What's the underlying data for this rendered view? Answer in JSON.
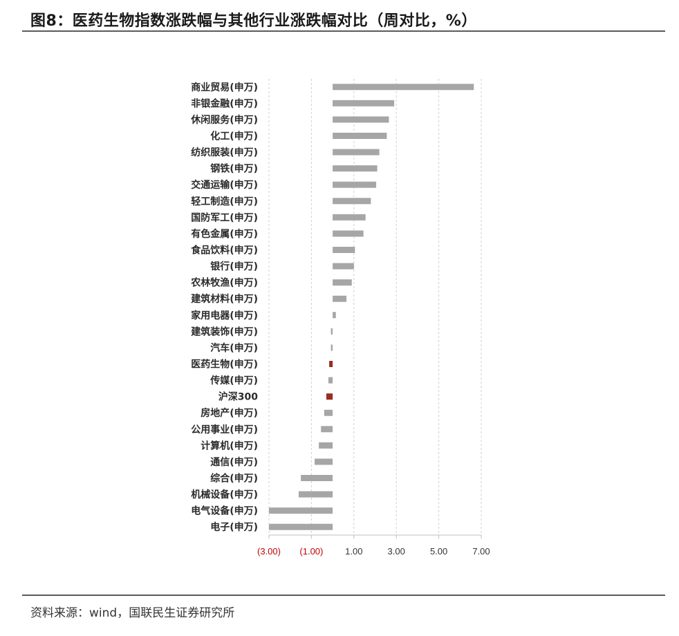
{
  "header": {
    "title": "图8：医药生物指数涨跌幅与其他行业涨跌幅对比（周对比，%）"
  },
  "footer": {
    "source": "资料来源：wind，国联民生证券研究所"
  },
  "colors": {
    "bar": "#a6a6a6",
    "highlight": "#9b2b24",
    "negative_tick": "#c00000",
    "tick": "#333333",
    "grid": "#cfcfcf"
  },
  "chart_data": {
    "type": "bar",
    "orientation": "horizontal",
    "categories": [
      "商业贸易(申万)",
      "非银金融(申万)",
      "休闲服务(申万)",
      "化工(申万)",
      "纺织服装(申万)",
      "钢铁(申万)",
      "交通运输(申万)",
      "轻工制造(申万)",
      "国防军工(申万)",
      "有色金属(申万)",
      "食品饮料(申万)",
      "银行(申万)",
      "农林牧渔(申万)",
      "建筑材料(申万)",
      "家用电器(申万)",
      "建筑装饰(申万)",
      "汽车(申万)",
      "医药生物(申万)",
      "传媒(申万)",
      "沪深300",
      "房地产(申万)",
      "公用事业(申万)",
      "计算机(申万)",
      "通信(申万)",
      "综合(申万)",
      "机械设备(申万)",
      "电气设备(申万)",
      "电子(申万)"
    ],
    "values": [
      6.65,
      2.9,
      2.65,
      2.55,
      2.2,
      2.1,
      2.05,
      1.8,
      1.55,
      1.45,
      1.05,
      1.0,
      0.9,
      0.65,
      0.15,
      -0.05,
      -0.05,
      -0.15,
      -0.2,
      -0.3,
      -0.4,
      -0.55,
      -0.65,
      -0.85,
      -1.5,
      -1.6,
      -3.0,
      -3.0
    ],
    "highlight": [
      "医药生物(申万)",
      "沪深300"
    ],
    "xlim": [
      -3.0,
      7.0
    ],
    "xticks": [
      -3,
      -1,
      1,
      3,
      5,
      7
    ],
    "xtick_labels": [
      "(3.00)",
      "(1.00)",
      "1.00",
      "3.00",
      "5.00",
      "7.00"
    ],
    "grid": "vertical-dashed",
    "legend": "none"
  }
}
